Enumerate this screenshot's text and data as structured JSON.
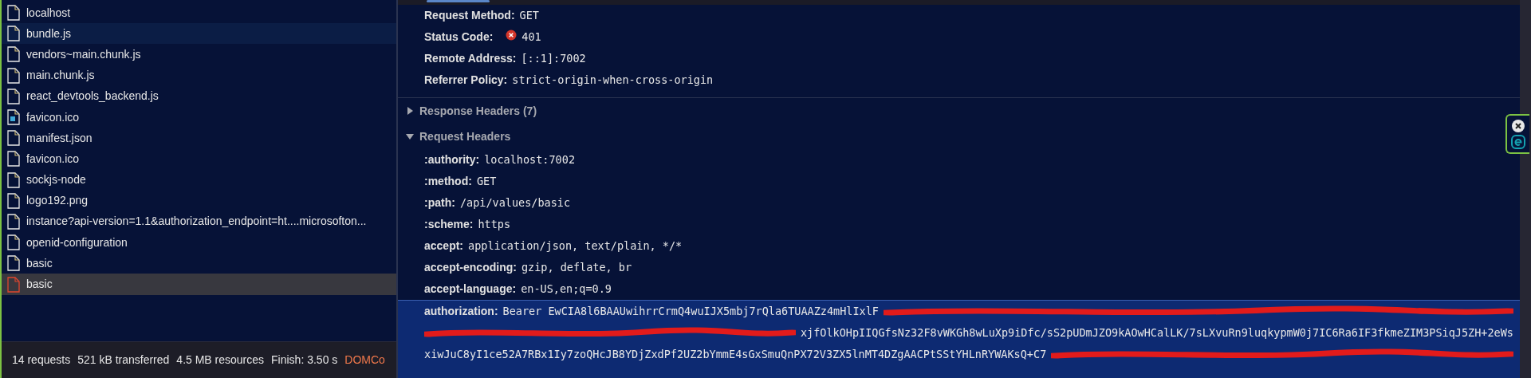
{
  "request_list": {
    "items": [
      {
        "name": "localhost",
        "kind": "file",
        "selected": false,
        "hovered": false,
        "error": false
      },
      {
        "name": "bundle.js",
        "kind": "file",
        "selected": false,
        "hovered": true,
        "error": false
      },
      {
        "name": "vendors~main.chunk.js",
        "kind": "file",
        "selected": false,
        "hovered": false,
        "error": false
      },
      {
        "name": "main.chunk.js",
        "kind": "file",
        "selected": false,
        "hovered": false,
        "error": false
      },
      {
        "name": "react_devtools_backend.js",
        "kind": "file",
        "selected": false,
        "hovered": false,
        "error": false
      },
      {
        "name": "favicon.ico",
        "kind": "image",
        "selected": false,
        "hovered": false,
        "error": false
      },
      {
        "name": "manifest.json",
        "kind": "file",
        "selected": false,
        "hovered": false,
        "error": false
      },
      {
        "name": "favicon.ico",
        "kind": "file",
        "selected": false,
        "hovered": false,
        "error": false
      },
      {
        "name": "sockjs-node",
        "kind": "file",
        "selected": false,
        "hovered": false,
        "error": false
      },
      {
        "name": "logo192.png",
        "kind": "file",
        "selected": false,
        "hovered": false,
        "error": false
      },
      {
        "name": "instance?api-version=1.1&authorization_endpoint=ht....microsofton...",
        "kind": "file",
        "selected": false,
        "hovered": false,
        "error": false
      },
      {
        "name": "openid-configuration",
        "kind": "file",
        "selected": false,
        "hovered": false,
        "error": false
      },
      {
        "name": "basic",
        "kind": "file",
        "selected": false,
        "hovered": false,
        "error": false
      },
      {
        "name": "basic",
        "kind": "file",
        "selected": true,
        "hovered": false,
        "error": true
      }
    ]
  },
  "status_bar": [
    {
      "text": "14 requests",
      "kind": "summary"
    },
    {
      "text": "521 kB transferred",
      "kind": "summary"
    },
    {
      "text": "4.5 MB resources",
      "kind": "summary"
    },
    {
      "text": "Finish: 3.50 s",
      "kind": "summary"
    },
    {
      "text": "DOMCo",
      "kind": "timing"
    }
  ],
  "general": [
    {
      "label": "Request Method:",
      "value": "GET",
      "error": false
    },
    {
      "label": "Status Code:",
      "value": "401",
      "error": true
    },
    {
      "label": "Remote Address:",
      "value": "[::1]:7002",
      "error": false
    },
    {
      "label": "Referrer Policy:",
      "value": "strict-origin-when-cross-origin",
      "error": false
    }
  ],
  "response_headers": {
    "title": "Response Headers (7)",
    "expanded": false
  },
  "request_headers": {
    "title": "Request Headers",
    "expanded": true,
    "headers": [
      {
        "label": ":authority:",
        "selected": false,
        "lines": [
          [
            {
              "kind": "text",
              "text": "localhost:7002"
            }
          ]
        ]
      },
      {
        "label": ":method:",
        "selected": false,
        "lines": [
          [
            {
              "kind": "text",
              "text": "GET"
            }
          ]
        ]
      },
      {
        "label": ":path:",
        "selected": false,
        "lines": [
          [
            {
              "kind": "text",
              "text": "/api/values/basic"
            }
          ]
        ]
      },
      {
        "label": ":scheme:",
        "selected": false,
        "lines": [
          [
            {
              "kind": "text",
              "text": "https"
            }
          ]
        ]
      },
      {
        "label": "accept:",
        "selected": false,
        "lines": [
          [
            {
              "kind": "text",
              "text": "application/json, text/plain, */*"
            }
          ]
        ]
      },
      {
        "label": "accept-encoding:",
        "selected": false,
        "lines": [
          [
            {
              "kind": "text",
              "text": "gzip, deflate, br"
            }
          ]
        ]
      },
      {
        "label": "accept-language:",
        "selected": false,
        "lines": [
          [
            {
              "kind": "text",
              "text": "en-US,en;q=0.9"
            }
          ]
        ]
      },
      {
        "label": "authorization:",
        "selected": true,
        "lines": [
          [
            {
              "kind": "text",
              "text": "Bearer EwCIA8l6BAAUwihrrCrmQ4wuIJX5mbj7rQla6TUAAZz4mHlIxlF"
            },
            {
              "kind": "redaction"
            }
          ],
          [
            {
              "kind": "redaction"
            },
            {
              "kind": "text",
              "text": "xjfOlkOHpIIQGfsNz32F8vWKGh8wLuXp9iDfc/sS2pUDmJZO9kAOwHCalLK/7sLXvuRn9luqkypmW0j7IC6Ra6IF3fkmeZIM3PSiqJ5ZH+2eWs"
            }
          ],
          [
            {
              "kind": "text",
              "text": "xiwJuC8yI1ce52A7RBx1Iy7zoQHcJB8YDjZxdPf2UZ2bYmmE4sGxSmuQnPX72V3ZX5lnMT4DZgAACPtSStYHLnRYWAKsQ+C7"
            },
            {
              "kind": "redaction"
            }
          ]
        ]
      }
    ]
  }
}
